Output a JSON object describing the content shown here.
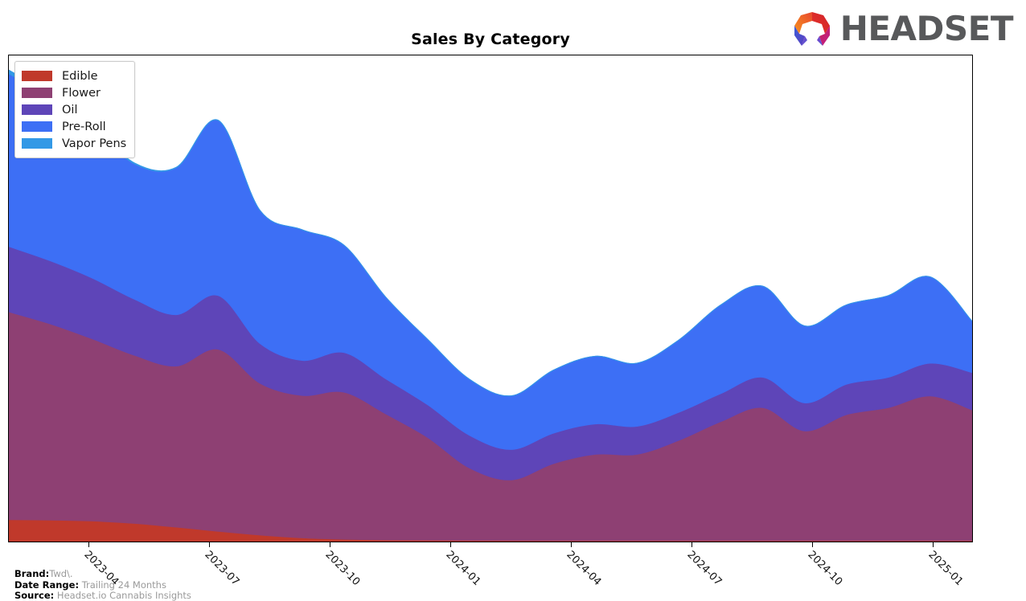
{
  "header": {
    "title": "Sales By Category",
    "logo_text": "HEADSET",
    "logo_mark_name": "headset-hexagon-logo"
  },
  "legend": {
    "position": "top-left",
    "items": [
      {
        "label": "Edible",
        "color": "#C0392B"
      },
      {
        "label": "Flower",
        "color": "#8E4073"
      },
      {
        "label": "Oil",
        "color": "#5E45B8"
      },
      {
        "label": "Pre-Roll",
        "color": "#3D6FF5"
      },
      {
        "label": "Vapor Pens",
        "color": "#3399E6"
      }
    ]
  },
  "footer": {
    "brand_key": "Brand:",
    "brand_value": "Twd\\.",
    "date_range_key": "Date Range:",
    "date_range_value": "Trailing 24 Months",
    "source_key": "Source:",
    "source_value": "Headset.io Cannabis Insights"
  },
  "chart_data": {
    "type": "area",
    "title": "Sales By Category",
    "xlabel": "",
    "ylabel": "",
    "stacked": true,
    "smoothing": "spline",
    "grid": false,
    "legend_position": "top-left",
    "axis": {
      "x_tick_labels": [
        "2023-04",
        "2023-07",
        "2023-10",
        "2024-01",
        "2024-04",
        "2024-07",
        "2024-10",
        "2025-01"
      ],
      "x_tick_positions": [
        0.0833,
        0.2083,
        0.3333,
        0.4583,
        0.5833,
        0.7083,
        0.8333,
        0.9583
      ],
      "y_axis_visible": false,
      "ylim": [
        0,
        100
      ]
    },
    "x": [
      "2023-02",
      "2023-03",
      "2023-04",
      "2023-05",
      "2023-06",
      "2023-07",
      "2023-08",
      "2023-09",
      "2023-10",
      "2023-11",
      "2023-12",
      "2024-01",
      "2024-02",
      "2024-03",
      "2024-04",
      "2024-05",
      "2024-06",
      "2024-07",
      "2024-08",
      "2024-09",
      "2024-10",
      "2024-11",
      "2024-12",
      "2025-01"
    ],
    "series": [
      {
        "name": "Edible",
        "color": "#C0392B",
        "values": [
          4.7,
          4.6,
          4.4,
          3.9,
          3.1,
          2.2,
          1.4,
          0.8,
          0.5,
          0.35,
          0.3,
          0.25,
          0.22,
          0.2,
          0.2,
          0.2,
          0.2,
          0.2,
          0.2,
          0.2,
          0.2,
          0.2,
          0.2,
          0.2
        ]
      },
      {
        "name": "Flower",
        "color": "#8E4073",
        "values": [
          44.5,
          42.0,
          39.0,
          36.0,
          34.5,
          39.0,
          32.5,
          30.5,
          31.5,
          27.0,
          22.0,
          15.5,
          13.0,
          16.5,
          18.5,
          18.5,
          21.5,
          25.5,
          28.5,
          23.5,
          27.0,
          28.5,
          31.0,
          28.0
        ]
      },
      {
        "name": "Oil",
        "color": "#5E45B8",
        "values": [
          14.0,
          13.5,
          13.0,
          12.0,
          11.0,
          11.5,
          8.5,
          7.5,
          8.5,
          7.5,
          7.0,
          7.0,
          6.5,
          6.5,
          6.5,
          6.0,
          6.0,
          6.0,
          6.5,
          6.0,
          6.5,
          6.5,
          7.0,
          8.0
        ]
      },
      {
        "name": "Pre-Roll",
        "color": "#3D6FF5",
        "values": [
          37.0,
          35.0,
          32.5,
          29.0,
          31.5,
          37.5,
          28.5,
          28.0,
          23.0,
          17.5,
          14.0,
          12.0,
          11.5,
          13.5,
          14.5,
          13.5,
          15.5,
          19.0,
          19.5,
          16.5,
          17.0,
          17.5,
          18.5,
          11.0
        ]
      },
      {
        "name": "Vapor Pens",
        "color": "#3399E6",
        "values": [
          0.8,
          0.6,
          0.4,
          0.2,
          0.1,
          0.05,
          0.0,
          0.0,
          0.0,
          0.0,
          0.0,
          0.0,
          0.0,
          0.0,
          0.0,
          0.0,
          0.0,
          0.0,
          0.0,
          0.0,
          0.0,
          0.0,
          0.0,
          0.0
        ]
      }
    ]
  }
}
